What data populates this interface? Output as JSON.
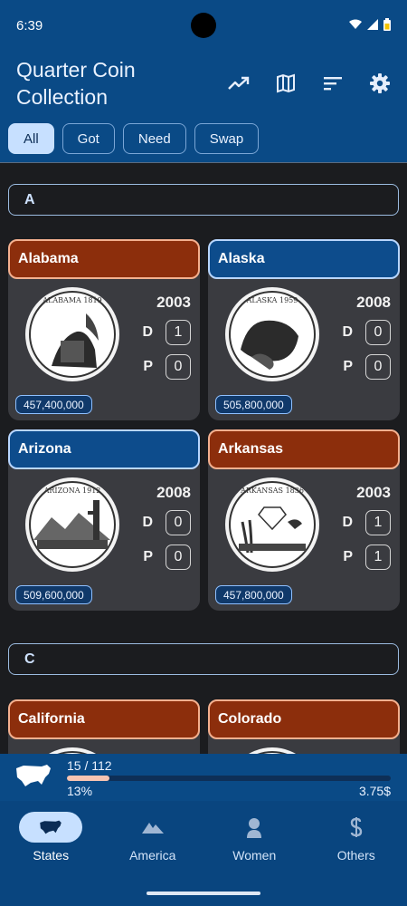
{
  "status_bar": {
    "time": "6:39"
  },
  "app": {
    "title": "Quarter Coin Collection"
  },
  "top_actions": [
    "trending-up-icon",
    "map-icon",
    "sort-icon",
    "settings-icon"
  ],
  "filters": [
    {
      "label": "All",
      "active": true
    },
    {
      "label": "Got",
      "active": false
    },
    {
      "label": "Need",
      "active": false
    },
    {
      "label": "Swap",
      "active": false
    }
  ],
  "sections": [
    {
      "letter": "A",
      "coins": [
        {
          "name": "Alabama",
          "status": "need",
          "year": "2003",
          "d": "1",
          "p": "0",
          "mintage": "457,400,000",
          "coin_text": "ALABAMA 1819"
        },
        {
          "name": "Alaska",
          "status": "got",
          "year": "2008",
          "d": "0",
          "p": "0",
          "mintage": "505,800,000",
          "coin_text": "ALASKA 1959"
        },
        {
          "name": "Arizona",
          "status": "got",
          "year": "2008",
          "d": "0",
          "p": "0",
          "mintage": "509,600,000",
          "coin_text": "ARIZONA 1912"
        },
        {
          "name": "Arkansas",
          "status": "need",
          "year": "2003",
          "d": "1",
          "p": "1",
          "mintage": "457,800,000",
          "coin_text": "ARKANSAS 1836"
        }
      ]
    },
    {
      "letter": "C",
      "coins": [
        {
          "name": "California",
          "status": "need"
        },
        {
          "name": "Colorado",
          "status": "need"
        }
      ]
    }
  ],
  "mint_labels": {
    "d": "D",
    "p": "P"
  },
  "progress": {
    "count": "15 / 112",
    "percent_text": "13%",
    "fraction": 0.13,
    "value": "3.75$"
  },
  "nav": [
    {
      "label": "States",
      "icon": "usa-map-icon",
      "active": true
    },
    {
      "label": "America",
      "icon": "mountain-icon",
      "active": false
    },
    {
      "label": "Women",
      "icon": "woman-icon",
      "active": false
    },
    {
      "label": "Others",
      "icon": "dollar-icon",
      "active": false
    }
  ],
  "colors": {
    "appbar": "#0a4a86",
    "need": "#8c2e0c",
    "got": "#0d4c8c",
    "background": "#1b1c1f",
    "progress_fill": "#f7c4b2"
  }
}
